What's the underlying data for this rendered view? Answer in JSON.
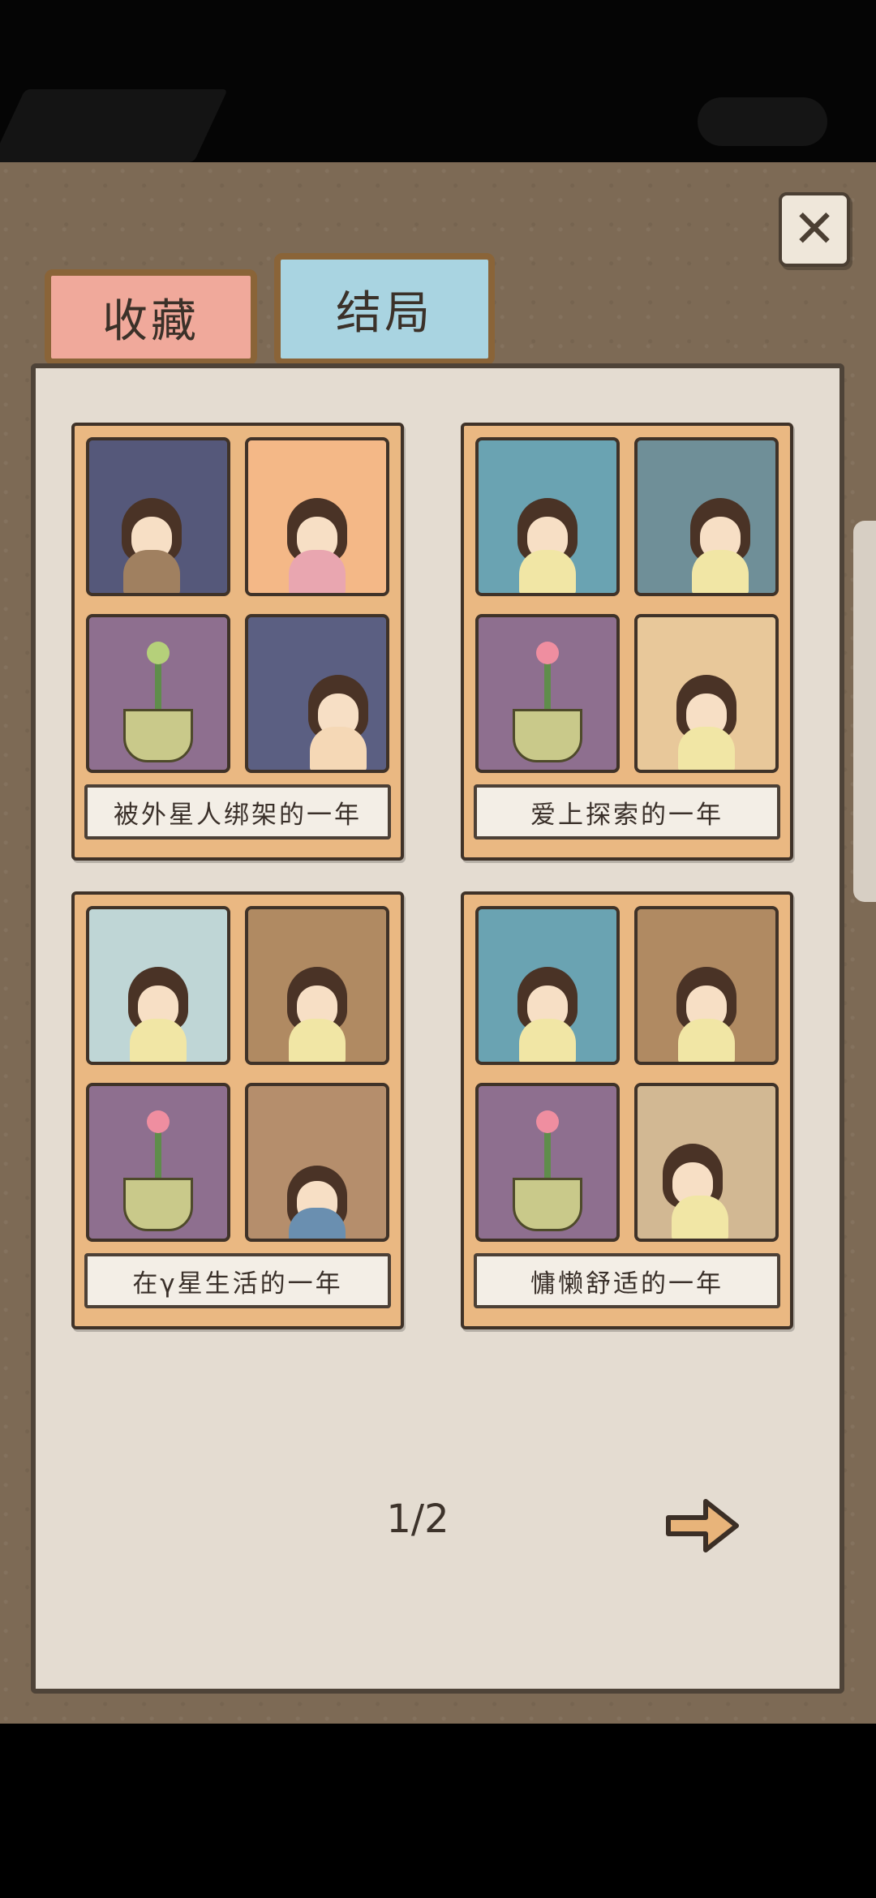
{
  "tabs": {
    "collect": "收藏",
    "ending": "结局"
  },
  "close_icon": "close-icon",
  "endings": [
    {
      "title": "被外星人绑架的一年"
    },
    {
      "title": "爱上探索的一年"
    },
    {
      "title": "在γ星生活的一年"
    },
    {
      "title": "慵懒舒适的一年"
    }
  ],
  "pagination": {
    "indicator": "1/2"
  },
  "colors": {
    "tab_collect": "#f0a99b",
    "tab_ending": "#a9d4e1",
    "card_frame": "#eab882",
    "panel": "#e4dcd1",
    "board": "#7d6a55"
  }
}
